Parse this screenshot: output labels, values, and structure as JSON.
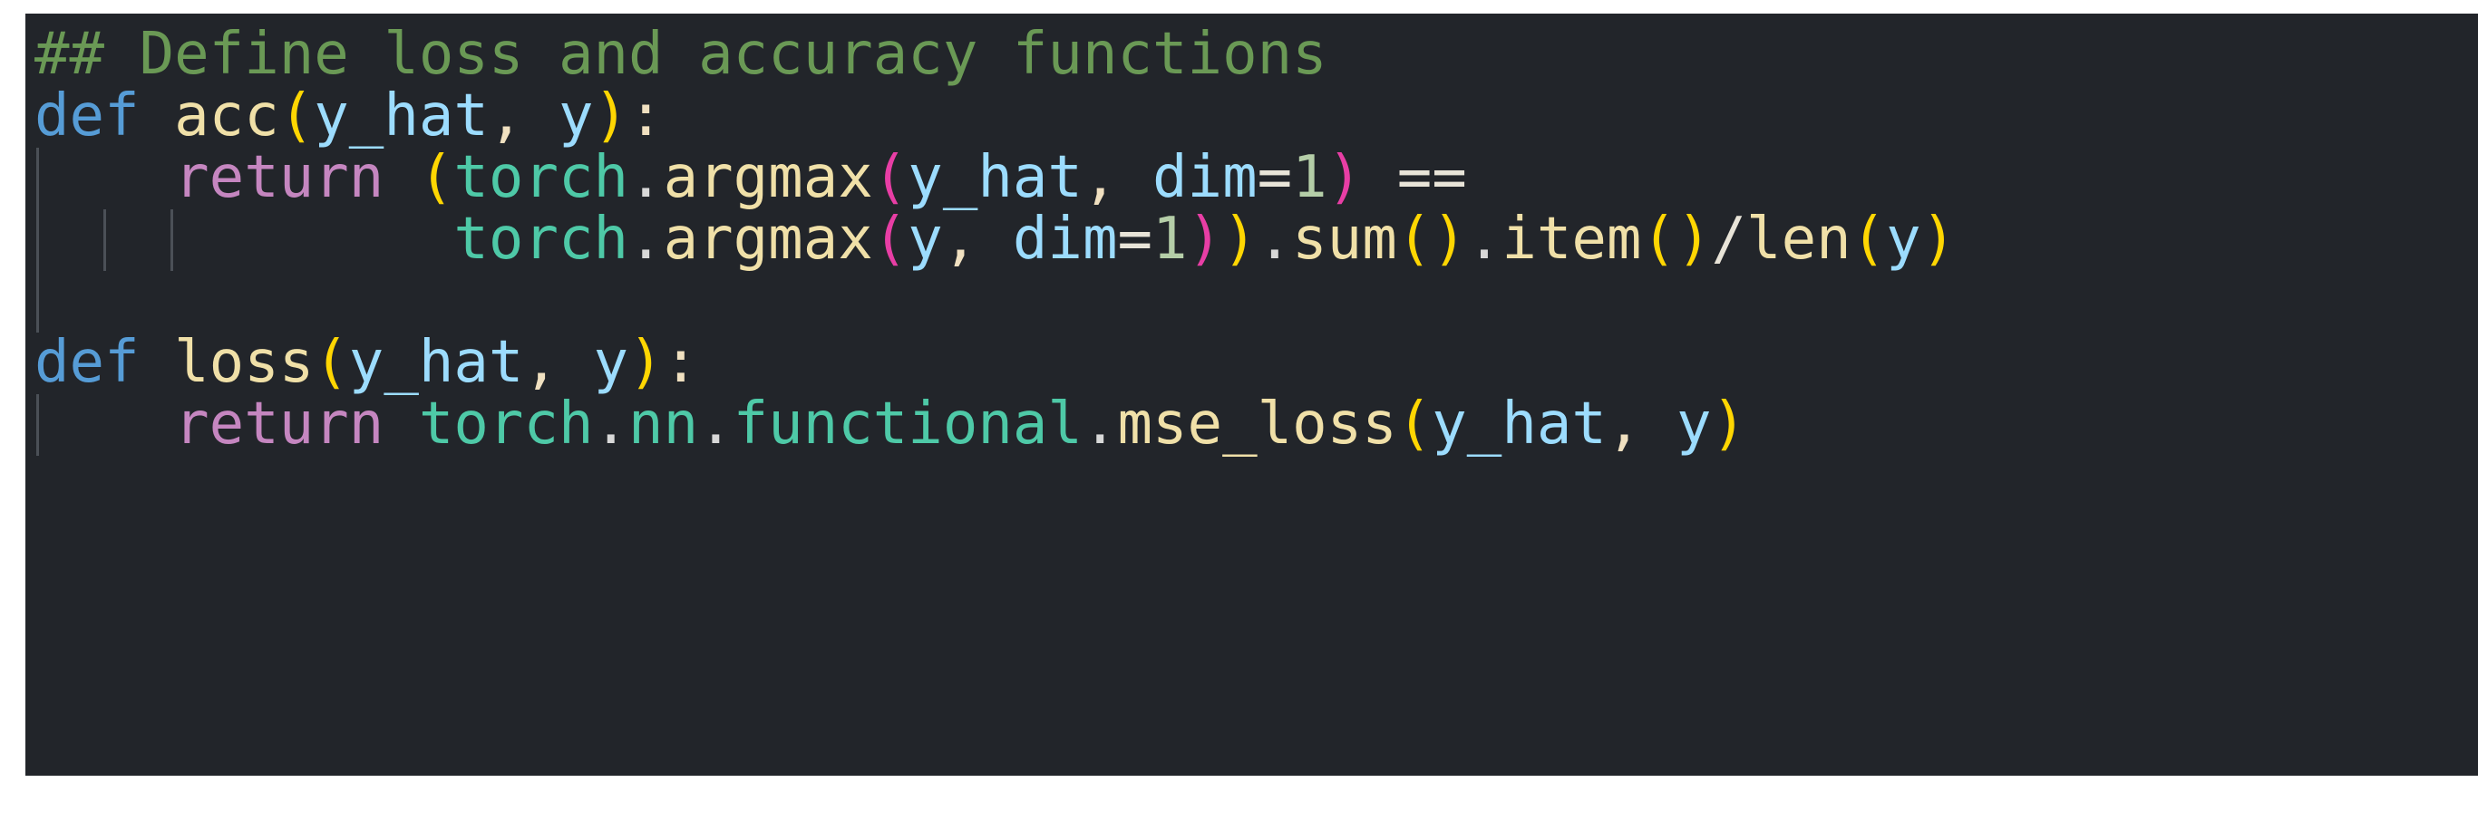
{
  "editor": {
    "language": "python",
    "background_color": "#22252a",
    "theme": "dark",
    "font_size_px": 64
  },
  "theme_colors": {
    "comment": "#6a9955",
    "keyword": "#569cd6",
    "return_keyword": "#c586c0",
    "function_name": "#f0e0a8",
    "module": "#4ec9a7",
    "parameter": "#9cdcfe",
    "number": "#b5cea8",
    "paren_level_1": "#ffd602",
    "paren_level_2": "#e83ea5",
    "punctuation": "#f0e0c0",
    "indent_guide": "#4b5057"
  },
  "code": {
    "lines": [
      {
        "n": 1,
        "text": "## Define loss and accuracy functions",
        "tokens": [
          {
            "t": "## Define loss and accuracy functions",
            "c": "cm"
          }
        ]
      },
      {
        "n": 2,
        "text": "def acc(y_hat, y):",
        "tokens": [
          {
            "t": "def",
            "c": "kw"
          },
          {
            "t": " ",
            "c": "pt"
          },
          {
            "t": "acc",
            "c": "fn"
          },
          {
            "t": "(",
            "c": "pl"
          },
          {
            "t": "y_hat",
            "c": "par"
          },
          {
            "t": ",",
            "c": "pt"
          },
          {
            "t": " ",
            "c": "pt"
          },
          {
            "t": "y",
            "c": "par"
          },
          {
            "t": ")",
            "c": "pl"
          },
          {
            "t": ":",
            "c": "pt"
          }
        ]
      },
      {
        "n": 3,
        "text": "    return (torch.argmax(y_hat, dim=1) ==",
        "tokens": [
          {
            "t": "    ",
            "c": "pt"
          },
          {
            "t": "return",
            "c": "ret"
          },
          {
            "t": " ",
            "c": "pt"
          },
          {
            "t": "(",
            "c": "pl"
          },
          {
            "t": "torch",
            "c": "mod"
          },
          {
            "t": ".",
            "c": "dot"
          },
          {
            "t": "argmax",
            "c": "fn"
          },
          {
            "t": "(",
            "c": "pm"
          },
          {
            "t": "y_hat",
            "c": "par"
          },
          {
            "t": ",",
            "c": "pt"
          },
          {
            "t": " ",
            "c": "pt"
          },
          {
            "t": "dim",
            "c": "par"
          },
          {
            "t": "=",
            "c": "op"
          },
          {
            "t": "1",
            "c": "num"
          },
          {
            "t": ")",
            "c": "pm"
          },
          {
            "t": " ",
            "c": "pt"
          },
          {
            "t": "==",
            "c": "op"
          }
        ]
      },
      {
        "n": 4,
        "text": "            torch.argmax(y, dim=1)).sum().item()/len(y)",
        "tokens": [
          {
            "t": "            ",
            "c": "pt"
          },
          {
            "t": "torch",
            "c": "mod"
          },
          {
            "t": ".",
            "c": "dot"
          },
          {
            "t": "argmax",
            "c": "fn"
          },
          {
            "t": "(",
            "c": "pm"
          },
          {
            "t": "y",
            "c": "par"
          },
          {
            "t": ",",
            "c": "pt"
          },
          {
            "t": " ",
            "c": "pt"
          },
          {
            "t": "dim",
            "c": "par"
          },
          {
            "t": "=",
            "c": "op"
          },
          {
            "t": "1",
            "c": "num"
          },
          {
            "t": ")",
            "c": "pm"
          },
          {
            "t": ")",
            "c": "pl"
          },
          {
            "t": ".",
            "c": "dot"
          },
          {
            "t": "sum",
            "c": "fn"
          },
          {
            "t": "()",
            "c": "pl"
          },
          {
            "t": ".",
            "c": "dot"
          },
          {
            "t": "item",
            "c": "fn"
          },
          {
            "t": "()",
            "c": "pl"
          },
          {
            "t": "/",
            "c": "op"
          },
          {
            "t": "len",
            "c": "fn"
          },
          {
            "t": "(",
            "c": "pl"
          },
          {
            "t": "y",
            "c": "par"
          },
          {
            "t": ")",
            "c": "pl"
          }
        ]
      },
      {
        "n": 5,
        "text": "",
        "tokens": []
      },
      {
        "n": 6,
        "text": "def loss(y_hat, y):",
        "tokens": [
          {
            "t": "def",
            "c": "kw"
          },
          {
            "t": " ",
            "c": "pt"
          },
          {
            "t": "loss",
            "c": "fn"
          },
          {
            "t": "(",
            "c": "pl"
          },
          {
            "t": "y_hat",
            "c": "par"
          },
          {
            "t": ",",
            "c": "pt"
          },
          {
            "t": " ",
            "c": "pt"
          },
          {
            "t": "y",
            "c": "par"
          },
          {
            "t": ")",
            "c": "pl"
          },
          {
            "t": ":",
            "c": "pt"
          }
        ]
      },
      {
        "n": 7,
        "text": "    return torch.nn.functional.mse_loss(y_hat, y)",
        "tokens": [
          {
            "t": "    ",
            "c": "pt"
          },
          {
            "t": "return",
            "c": "ret"
          },
          {
            "t": " ",
            "c": "pt"
          },
          {
            "t": "torch",
            "c": "mod"
          },
          {
            "t": ".",
            "c": "dot"
          },
          {
            "t": "nn",
            "c": "mod"
          },
          {
            "t": ".",
            "c": "dot"
          },
          {
            "t": "functional",
            "c": "mod"
          },
          {
            "t": ".",
            "c": "dot"
          },
          {
            "t": "mse_loss",
            "c": "fn"
          },
          {
            "t": "(",
            "c": "pl"
          },
          {
            "t": "y_hat",
            "c": "par"
          },
          {
            "t": ",",
            "c": "pt"
          },
          {
            "t": " ",
            "c": "pt"
          },
          {
            "t": "y",
            "c": "par"
          },
          {
            "t": ")",
            "c": "pl"
          }
        ]
      }
    ],
    "indent_guides": [
      {
        "line": 3,
        "levels": 1
      },
      {
        "line": 4,
        "levels": 3
      },
      {
        "line": 5,
        "levels": 1
      },
      {
        "line": 7,
        "levels": 1
      }
    ]
  }
}
